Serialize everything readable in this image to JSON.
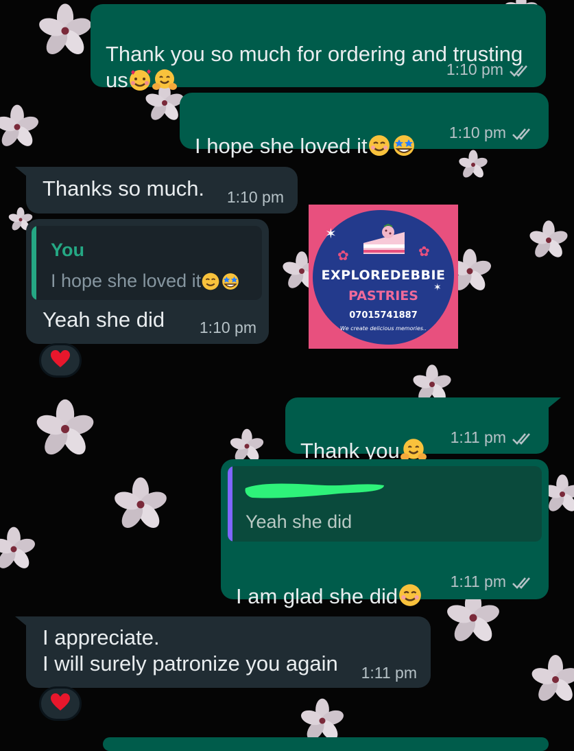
{
  "colors": {
    "outgoing_bubble": "#005c4b",
    "incoming_bubble": "#202c33",
    "read_ticks": "#b6c2c7",
    "quote_author_you": "#25a884",
    "promo_bg": "#e8507e",
    "promo_blob": "#233a8c"
  },
  "messages": [
    {
      "id": "m1",
      "direction": "outgoing",
      "text": "Thank you so much for ordering and trusting us",
      "emojis": [
        "smiling-face-with-hearts-icon",
        "hugging-face-icon"
      ],
      "time": "1:10 pm",
      "status": "read"
    },
    {
      "id": "m2",
      "direction": "outgoing",
      "text": "I hope she loved it",
      "emojis": [
        "smiling-face-icon",
        "star-struck-icon"
      ],
      "time": "1:10 pm",
      "status": "read"
    },
    {
      "id": "m3",
      "direction": "incoming",
      "text": "Thanks so much.",
      "time": "1:10 pm"
    },
    {
      "id": "m4",
      "direction": "incoming",
      "quote": {
        "author": "You",
        "text": "I hope she loved it",
        "emojis": [
          "smiling-face-icon",
          "star-struck-icon"
        ]
      },
      "text": "Yeah she did",
      "time": "1:10 pm",
      "reaction": "red-heart-icon"
    },
    {
      "id": "m5",
      "direction": "outgoing",
      "text": "Thank you",
      "emojis": [
        "hugging-face-icon"
      ],
      "time": "1:11 pm",
      "status": "read"
    },
    {
      "id": "m6",
      "direction": "outgoing",
      "quote": {
        "author": "",
        "author_redacted": true,
        "text": "Yeah she did"
      },
      "text": "I am glad she did",
      "emojis": [
        "smiling-face-icon"
      ],
      "time": "1:11 pm",
      "status": "read"
    },
    {
      "id": "m7",
      "direction": "incoming",
      "text": "I appreciate.\nI will surely patronize you again",
      "time": "1:11 pm",
      "reaction": "red-heart-icon"
    }
  ],
  "promo": {
    "brand_line1": "EXPLOREDEBBIE",
    "brand_line2": "PASTRIES",
    "phone": "07015741887",
    "tagline": "We create delicious memories.."
  }
}
